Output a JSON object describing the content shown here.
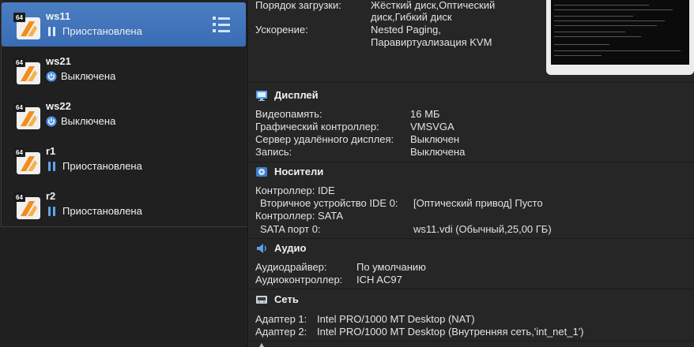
{
  "vm_list": [
    {
      "name": "ws11",
      "state": "Приостановлена",
      "state_kind": "paused",
      "selected": true
    },
    {
      "name": "ws21",
      "state": "Выключена",
      "state_kind": "off",
      "selected": false
    },
    {
      "name": "ws22",
      "state": "Выключена",
      "state_kind": "off",
      "selected": false
    },
    {
      "name": "r1",
      "state": "Приостановлена",
      "state_kind": "paused",
      "selected": false
    },
    {
      "name": "r2",
      "state": "Приостановлена",
      "state_kind": "paused",
      "selected": false
    }
  ],
  "vm_icon_badge": "64",
  "system": {
    "boot_order_label": "Порядок загрузки:",
    "boot_order_value_1": "Жёсткий диск,Оптический",
    "boot_order_value_2": "диск,Гибкий диск",
    "accel_label": "Ускорение:",
    "accel_value_1": "Nested Paging,",
    "accel_value_2": "Паравиртуализация KVM"
  },
  "display": {
    "title": "Дисплей",
    "rows": [
      {
        "label": "Видеопамять:",
        "value": "16 МБ"
      },
      {
        "label": "Графический контроллер:",
        "value": "VMSVGA"
      },
      {
        "label": "Сервер удалённого дисплея:",
        "value": "Выключен"
      },
      {
        "label": "Запись:",
        "value": "Выключена"
      }
    ]
  },
  "storage": {
    "title": "Носители",
    "controller_ide": "Контроллер: IDE",
    "ide_port_label": "Вторичное устройство IDE 0:",
    "ide_port_value": "[Оптический привод] Пусто",
    "controller_sata": "Контроллер: SATA",
    "sata_port_label": "SATA порт 0:",
    "sata_port_value": "ws11.vdi (Обычный,25,00 ГБ)"
  },
  "audio": {
    "title": "Аудио",
    "driver_label": "Аудиодрайвер:",
    "driver_value": "По умолчанию",
    "controller_label": "Аудиоконтроллер:",
    "controller_value": "ICH AC97"
  },
  "network": {
    "title": "Сеть",
    "adapter1_label": "Адаптер 1:",
    "adapter1_value": "Intel PRO/1000 MT Desktop (NAT)",
    "adapter2_label": "Адаптер 2:",
    "adapter2_value": "Intel PRO/1000 MT Desktop (Внутренняя сеть,'int_net_1')"
  },
  "colors": {
    "selection": "#3f72b8",
    "state_icon": "#5fa7f0",
    "background": "#262626"
  },
  "icons": {
    "vm": "os-64bit-icon",
    "paused": "pause-icon",
    "off": "power-off-icon",
    "menu": "details-menu-icon",
    "display": "monitor-icon",
    "storage": "disk-icon",
    "audio": "speaker-icon",
    "network": "network-icon"
  }
}
